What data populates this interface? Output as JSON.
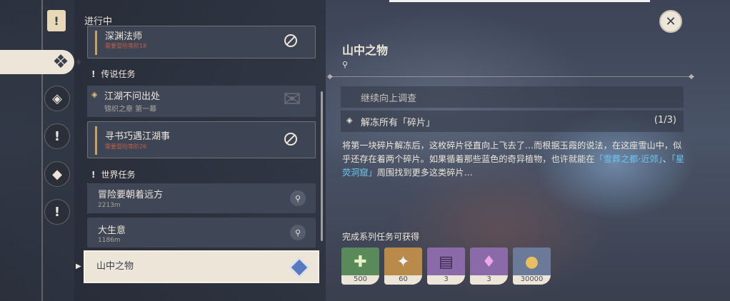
{
  "panel": {
    "title": "进行中"
  },
  "quest_list": {
    "top_quest": {
      "title": "深渊法师",
      "requirement": "需要冒险等阶18"
    },
    "legendary_section": {
      "label": "传说任务"
    },
    "legendary_quest": {
      "title": "江湖不问出处",
      "chapter": "锦织之章 第一幕"
    },
    "legendary_sub": {
      "title": "寻书巧遇江湖事",
      "requirement": "需要冒险等阶26"
    },
    "world_section": {
      "label": "世界任务"
    },
    "world_quests": [
      {
        "title": "冒险要朝着远方",
        "distance": "2213m"
      },
      {
        "title": "大生意",
        "distance": "1186m"
      }
    ],
    "selected": {
      "title": "山中之物"
    }
  },
  "detail": {
    "title": "山中之物",
    "objective_prev": "继续向上调查",
    "objective_current": "解冻所有「碎片」",
    "objective_count": "(1/3)",
    "desc_part1": "将第一块碎片解冻后，这枚碎片径直向上飞去了…而根据玉霞的说法，在这座雪山中，似乎还存在着两个碎片。如果循着那些蓝色的奇异植物，也许就能在",
    "desc_hl1": "「雪葬之都·近郊」",
    "desc_mid": "、",
    "desc_hl2": "「星荧洞窟」",
    "desc_part2": "周围找到更多这类碎片…",
    "reward_label": "完成系列任务可获得",
    "rewards": [
      {
        "name": "adventure-exp",
        "qty": "500"
      },
      {
        "name": "primogem",
        "qty": "60"
      },
      {
        "name": "talent-book",
        "qty": "3"
      },
      {
        "name": "crystal",
        "qty": "3"
      },
      {
        "name": "mora",
        "qty": "30000"
      }
    ]
  },
  "colors": {
    "accent": "#ece5d8",
    "highlight": "#6cc6f0",
    "warning": "#c0604a"
  }
}
